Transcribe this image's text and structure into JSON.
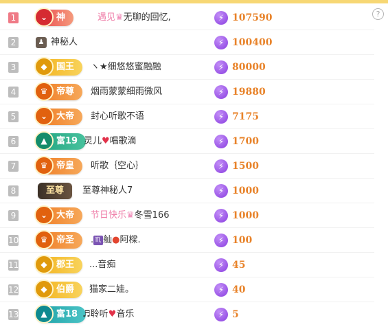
{
  "help_icon": "?",
  "colors": {
    "accent": "#f7d774",
    "score": "#e8832a",
    "pink_name": "#ef7ea8"
  },
  "rows": [
    {
      "rank": "1",
      "badge": "神",
      "badge_icon": "⌄",
      "name_pink": "遇见",
      "name_rest": "无聊的回忆,",
      "icon": "crown-icon",
      "score": "107590"
    },
    {
      "rank": "2",
      "badge": "",
      "name": "神秘人",
      "avatar": "mystery-avatar",
      "score": "100400"
    },
    {
      "rank": "3",
      "badge": "国王",
      "badge_icon": "◆",
      "name": "ヽ★细悠悠蜜融融",
      "score": "80000"
    },
    {
      "rank": "4",
      "badge": "帝尊",
      "badge_icon": "♛",
      "name": "烟雨蒙蒙细雨微风",
      "score": "19880"
    },
    {
      "rank": "5",
      "badge": "大帝",
      "badge_icon": "⌄",
      "name": "封心听歌不语",
      "score": "7175"
    },
    {
      "rank": "6",
      "badge": "富19",
      "badge_icon": "▲",
      "name_a": "灵儿",
      "name_b": "唱歌滴",
      "score": "1700"
    },
    {
      "rank": "7",
      "badge": "帝皇",
      "badge_icon": "♛",
      "name": "听歌｛空心｝",
      "score": "1500"
    },
    {
      "rank": "8",
      "badge": "至尊",
      "name": "至尊神秘人7",
      "score": "1000"
    },
    {
      "rank": "9",
      "badge": "大帝",
      "badge_icon": "⌄",
      "name_pink": "节日快乐",
      "name_rest": "冬雪166",
      "score": "1000"
    },
    {
      "rank": "10",
      "badge": "帝圣",
      "badge_icon": "♛",
      "name_a": ".",
      "name_b": "舢",
      "name_c": "阿樑.",
      "score": "100"
    },
    {
      "rank": "11",
      "badge": "郡王",
      "badge_icon": "◆",
      "name": "...音痴",
      "score": "45"
    },
    {
      "rank": "12",
      "badge": "伯爵",
      "badge_icon": "◆",
      "name": "猫家二娃。",
      "score": "40"
    },
    {
      "rank": "13",
      "badge": "富18",
      "badge_icon": "▲",
      "name_a": "♬聆听",
      "name_b": "音乐",
      "score": "5"
    }
  ]
}
